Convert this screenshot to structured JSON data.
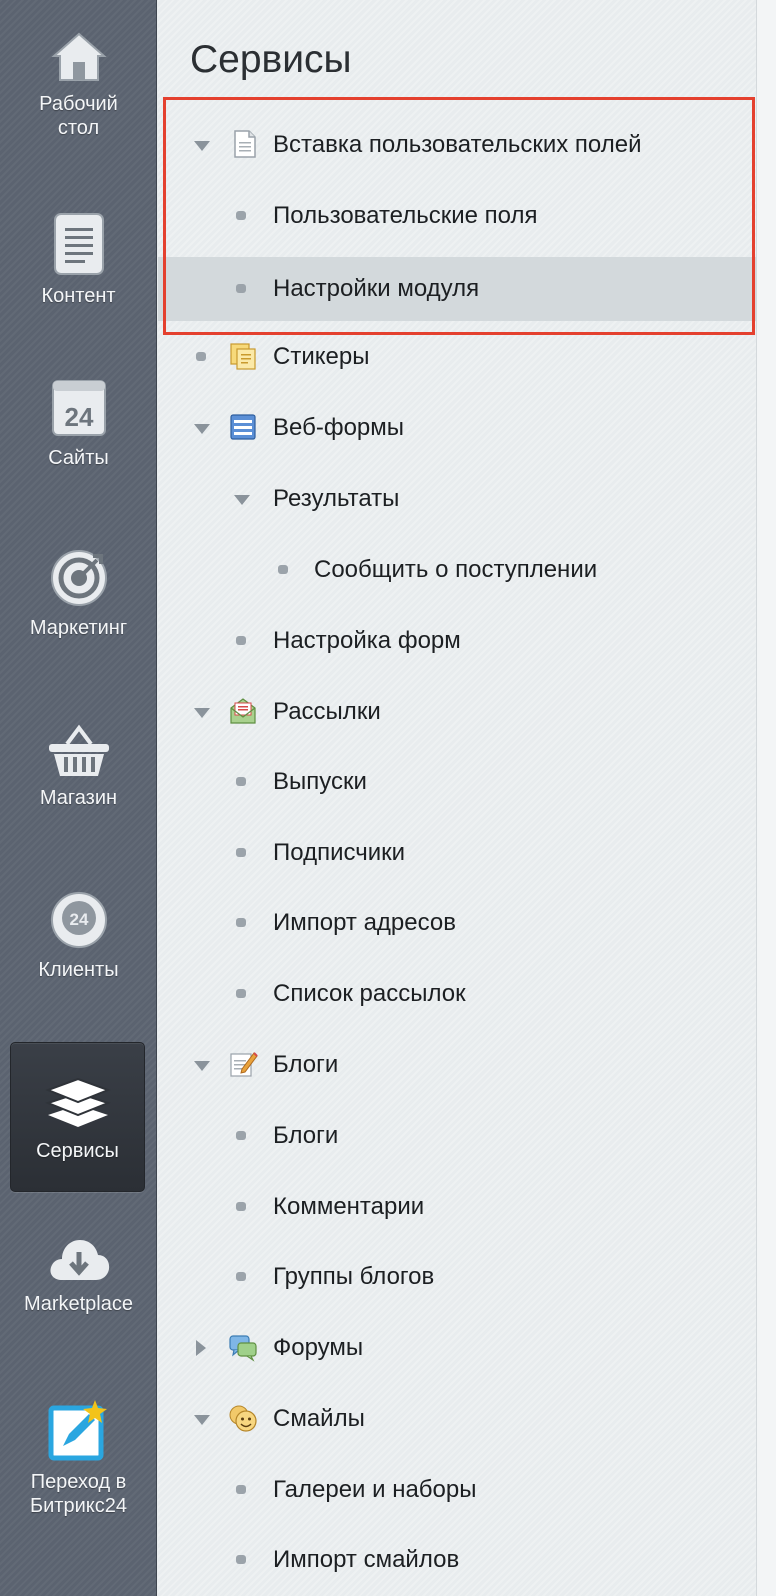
{
  "sidebar": {
    "items": [
      {
        "label": "Рабочий стол",
        "icon": "home-icon"
      },
      {
        "label": "Контент",
        "icon": "document-icon"
      },
      {
        "label": "Сайты",
        "icon": "sites-24-icon"
      },
      {
        "label": "Маркетинг",
        "icon": "target-icon"
      },
      {
        "label": "Магазин",
        "icon": "basket-icon"
      },
      {
        "label": "Клиенты",
        "icon": "clients-24-icon"
      },
      {
        "label": "Сервисы",
        "icon": "layers-icon",
        "active": true
      },
      {
        "label": "Marketplace",
        "icon": "cloud-download-icon"
      },
      {
        "label": "Переход в Битрикс24",
        "icon": "bitrix24-transition-icon"
      }
    ]
  },
  "main": {
    "title": "Сервисы",
    "tree": [
      {
        "label": "Вставка пользовательских полей",
        "icon": "page-icon",
        "expanded": true
      },
      {
        "label": "Пользовательские поля"
      },
      {
        "label": "Настройки модуля",
        "selected": true
      },
      {
        "label": "Стикеры",
        "icon": "stickers-icon"
      },
      {
        "label": "Веб-формы",
        "icon": "webform-icon",
        "expanded": true
      },
      {
        "label": "Результаты",
        "expanded": true
      },
      {
        "label": "Сообщить о поступлении"
      },
      {
        "label": "Настройка форм"
      },
      {
        "label": "Рассылки",
        "icon": "mail-icon",
        "expanded": true
      },
      {
        "label": "Выпуски"
      },
      {
        "label": "Подписчики"
      },
      {
        "label": "Импорт адресов"
      },
      {
        "label": "Список рассылок"
      },
      {
        "label": "Блоги",
        "icon": "blog-icon",
        "expanded": true
      },
      {
        "label": "Блоги"
      },
      {
        "label": "Комментарии"
      },
      {
        "label": "Группы блогов"
      },
      {
        "label": "Форумы",
        "icon": "forum-icon",
        "expanded": false
      },
      {
        "label": "Смайлы",
        "icon": "smile-icon",
        "expanded": true
      },
      {
        "label": "Галереи и наборы"
      },
      {
        "label": "Импорт смайлов"
      }
    ]
  },
  "colors": {
    "sidebar_bg": "#5b6370",
    "content_bg": "#e8ecee",
    "selected_row": "#d3d9dc",
    "highlight_border": "#e4402e"
  }
}
